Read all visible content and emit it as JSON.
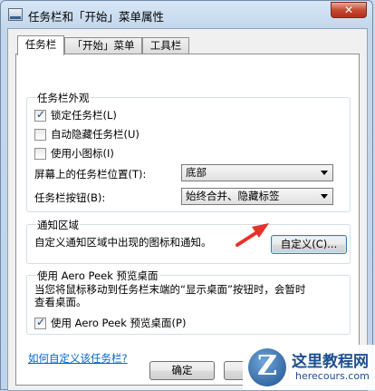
{
  "window": {
    "title": "任务栏和「开始」菜单属性",
    "close_label": "✕"
  },
  "tabs": [
    {
      "label": "任务栏",
      "active": true
    },
    {
      "label": "「开始」菜单",
      "active": false
    },
    {
      "label": "工具栏",
      "active": false
    }
  ],
  "appearance": {
    "group_title": "任务栏外观",
    "lock_taskbar": {
      "label": "锁定任务栏(L)",
      "checked": true
    },
    "auto_hide": {
      "label": "自动隐藏任务栏(U)",
      "checked": false
    },
    "small_icons": {
      "label": "使用小图标(I)",
      "checked": false
    },
    "location_label": "屏幕上的任务栏位置(T):",
    "location_value": "底部",
    "buttons_label": "任务栏按钮(B):",
    "buttons_value": "始终合并、隐藏标签"
  },
  "notification": {
    "group_title": "通知区域",
    "description": "自定义通知区域中出现的图标和通知。",
    "customize_button": "自定义(C)..."
  },
  "aero_peek": {
    "group_title": "使用 Aero Peek 预览桌面",
    "description_line1": "当您将鼠标移动到任务栏末端的“显示桌面”按钮时，会暂时",
    "description_line2": "查看桌面。",
    "checkbox": {
      "label": "使用 Aero Peek 预览桌面(P)",
      "checked": true
    }
  },
  "help_link": "如何自定义该任务栏?",
  "footer": {
    "ok_button": "确定"
  },
  "watermark": {
    "title": "这里教程网",
    "subtitle": "herecours.com",
    "logo_letter": "Z"
  },
  "colors": {
    "annotation_arrow": "#e8322a",
    "link": "#0066cc"
  }
}
